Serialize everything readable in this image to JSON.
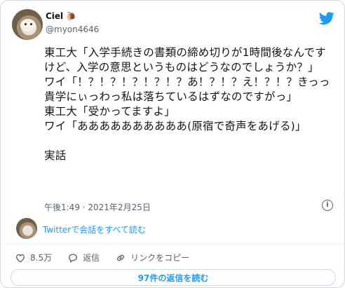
{
  "author": {
    "name": "Ciel",
    "badge_emoji": "🐌",
    "handle": "@myon4646"
  },
  "icons": {
    "twitter": "twitter-bird-icon",
    "info": "info-icon",
    "like": "heart-icon",
    "reply": "reply-icon",
    "copy_link": "link-icon"
  },
  "tweet": {
    "text": "東工大「入学手続きの書類の締め切りが1時間後なんですけど、入学の意思というものはどうなのでしょうか？」\nワイ「！？！？！？！？！？あ！？！？え！？！？きっっ貴学にぃっわっ私は落ちているはずなのですがっ」\n東工大「受かってますよ」\nワイ「ああああああああああ(原宿で奇声をあげる)」\n\n実話",
    "timestamp": "午後1:49 · 2021年2月25日"
  },
  "thread": {
    "link_text": "Twitterで会話をすべて読む"
  },
  "actions": {
    "likes": "8.5万",
    "reply_label": "返信",
    "copy_link_label": "リンクをコピー"
  },
  "footer": {
    "read_replies_label": "97件の返信を読む"
  },
  "colors": {
    "accent": "#1d9bf0",
    "like": "#f91880",
    "muted": "#536471",
    "border": "#cfd9de"
  }
}
